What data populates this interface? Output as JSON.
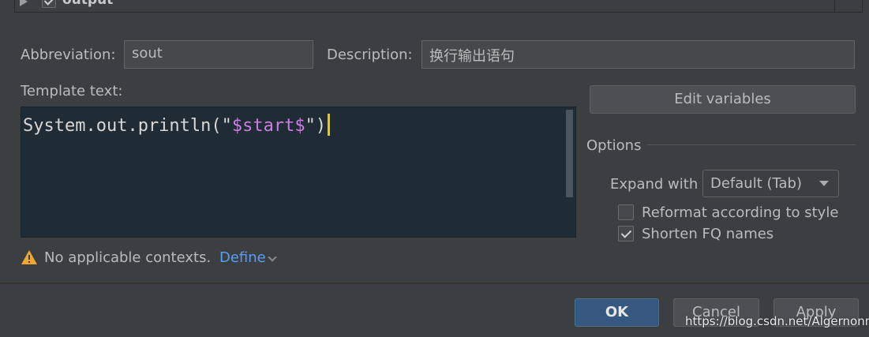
{
  "tree": {
    "item_label": "output",
    "checked": true
  },
  "abbreviation": {
    "label": "Abbreviation:",
    "value": "sout"
  },
  "description": {
    "label": "Description:",
    "value": "换行输出语句"
  },
  "template": {
    "label": "Template text:",
    "code_prefix": "System.out.println(\"",
    "code_variable": "$start$",
    "code_suffix": "\")"
  },
  "edit_variables": {
    "label": "Edit variables"
  },
  "options": {
    "heading": "Options",
    "expand_label": "Expand with",
    "expand_value": "Default (Tab)",
    "reformat_label": "Reformat according to style",
    "reformat_checked": false,
    "shorten_label": "Shorten FQ names",
    "shorten_checked": true
  },
  "context": {
    "warning_text": "No applicable contexts.",
    "define_label": "Define",
    "warning_icon": "warning-icon"
  },
  "footer": {
    "ok": "OK",
    "cancel": "Cancel",
    "apply": "Apply"
  },
  "watermark": "https://blog.csdn.net/Algernonm",
  "colors": {
    "background": "#3c3f41",
    "editor_bg": "#1f2b35",
    "accent": "#365880",
    "link": "#589df6",
    "warning": "#f0a732"
  }
}
